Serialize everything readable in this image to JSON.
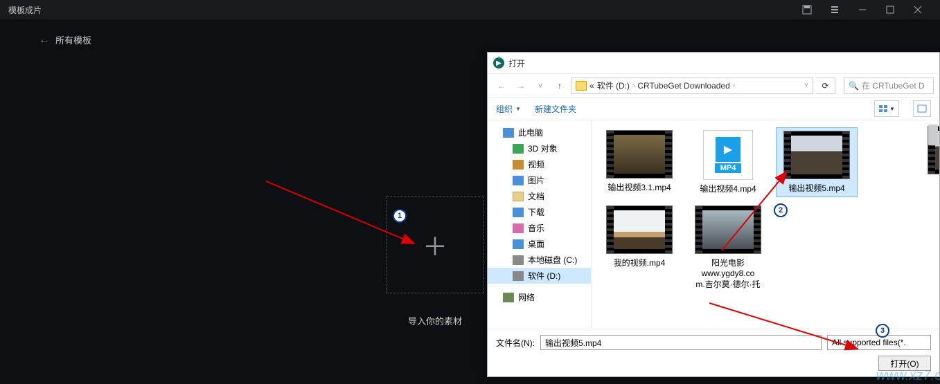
{
  "app": {
    "title": "模板成片",
    "back_label": "所有模板",
    "drop_caption": "导入你的素材"
  },
  "dialog": {
    "title": "打开",
    "breadcrumb": {
      "part1": "软件 (D:)",
      "part2": "CRTubeGet Downloaded"
    },
    "search_placeholder": "在 CRTubeGet D",
    "toolbar": {
      "organize": "组织",
      "new_folder": "新建文件夹"
    },
    "tree": {
      "this_pc": "此电脑",
      "objects_3d": "3D 对象",
      "videos": "视频",
      "pictures": "图片",
      "documents": "文档",
      "downloads": "下载",
      "music": "音乐",
      "desktop": "桌面",
      "disk_c": "本地磁盘 (C:)",
      "disk_d": "软件 (D:)",
      "network": "网络"
    },
    "files": {
      "f1": "输出视频3.1.mp4",
      "f2": "输出视频4.mp4",
      "f3": "输出视频5.mp4",
      "f4": "我的视频.mp4",
      "f5_line1": "阳光电影",
      "f5_line2": "www.ygdy8.co",
      "f5_line3": "m.吉尔莫·德尔·托",
      "mp4_label": "MP4"
    },
    "filename_label": "文件名(N):",
    "filename_value": "输出视频5.mp4",
    "filetype": "All supported files(*.",
    "open_btn": "打开(O)"
  }
}
